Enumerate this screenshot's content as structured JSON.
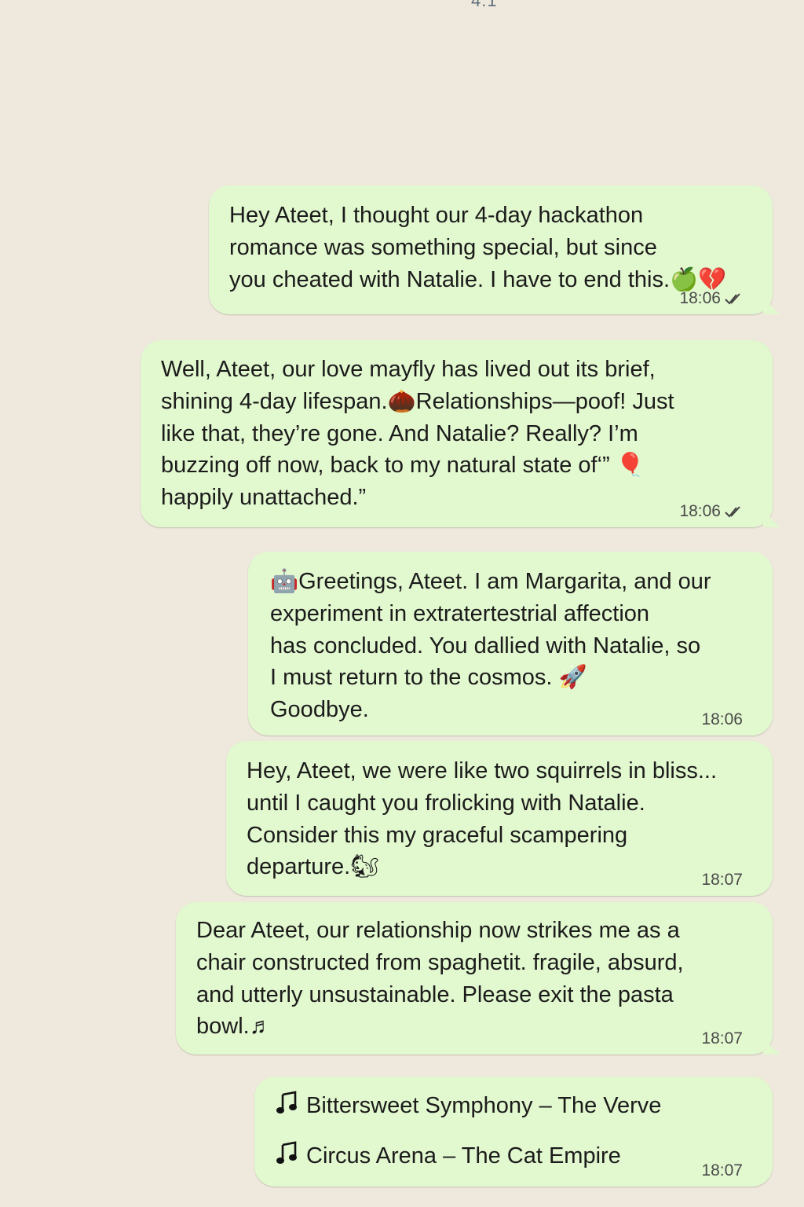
{
  "status_bar": {
    "cropped_time": "4:1"
  },
  "messages": [
    {
      "text": "Hey Ateet, I thought our 4-day hackathon\nromance was something special, but since\nyou cheated with Natalie. I have to end this.🍏💔",
      "time": "18:06",
      "status": "sent"
    },
    {
      "text": "Well, Ateet, our love mayfly has lived out its brief,\nshining 4-day lifespan.🌰Relationships—poof! Just\nlike that, they’re gone. And Natalie? Really? I’m\nbuzzing off now, back to my natural state of‘” 🎈\nhappily unattached.”",
      "time": "18:06",
      "status": "sent"
    },
    {
      "text": "🤖Greetings, Ateet. I am Margarita, and our\nexperiment in extratertestrial affection\nhas concluded. You dallied with Natalie, so\nI must return to the cosmos. 🚀\nGoodbye.",
      "time": "18:06"
    },
    {
      "text": "Hey, Ateet, we were like two squirrels in bliss...\nuntil I caught you frolicking with Natalie.\nConsider this my graceful scampering\ndeparture.🐿",
      "time": "18:07"
    },
    {
      "text": "Dear Ateet, our relationship now strikes me as a\nchair constructed from spaghetit. fragile, absurd,\nand utterly unsustainable. Please exit the pasta\nbowl.♬",
      "time": "18:07"
    }
  ],
  "playlist": {
    "songs": [
      "Bittersweet Symphony – The Verve",
      "Circus Arena – The Cat Empire"
    ],
    "note_icon": "music-note-icon",
    "time": "18:07"
  }
}
